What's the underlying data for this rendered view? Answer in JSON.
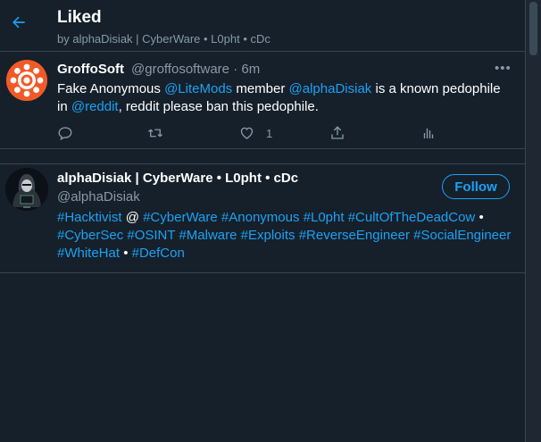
{
  "header": {
    "title": "Liked",
    "subtitle": "by alphaDisiak | CyberWare • L0pht • cDc"
  },
  "tweet": {
    "display_name": "GroffoSoft",
    "handle": "@groffosoftware",
    "separator": "·",
    "time": "6m",
    "more": "•••",
    "body": [
      {
        "t": "Fake Anonymous ",
        "link": false
      },
      {
        "t": "@LiteMods",
        "link": true
      },
      {
        "t": " member ",
        "link": false
      },
      {
        "t": "@alphaDisiak",
        "link": true
      },
      {
        "t": " is a known pedophile in ",
        "link": false
      },
      {
        "t": "@reddit",
        "link": true
      },
      {
        "t": ", reddit please ban this pedophile.",
        "link": false
      }
    ],
    "like_count": "1",
    "icons": [
      "reply-icon",
      "retweet-icon",
      "like-icon",
      "share-icon",
      "analytics-icon"
    ]
  },
  "user": {
    "display_name": "alphaDisiak | CyberWare • L0pht • cDc",
    "handle": "@alphaDisiak",
    "follow_label": "Follow",
    "bio": [
      {
        "t": "#Hacktivist",
        "link": true
      },
      {
        "t": " @ ",
        "link": false
      },
      {
        "t": "#CyberWare",
        "link": true
      },
      {
        "t": " ",
        "link": false
      },
      {
        "t": "#Anonymous",
        "link": true
      },
      {
        "t": " ",
        "link": false
      },
      {
        "t": "#L0pht",
        "link": true
      },
      {
        "t": " ",
        "link": false
      },
      {
        "t": "#CultOfTheDeadCow",
        "link": true
      },
      {
        "t": " • ",
        "link": false
      },
      {
        "t": "#CyberSec",
        "link": true
      },
      {
        "t": " ",
        "link": false
      },
      {
        "t": "#OSINT",
        "link": true
      },
      {
        "t": " ",
        "link": false
      },
      {
        "t": "#Malware",
        "link": true
      },
      {
        "t": " ",
        "link": false
      },
      {
        "t": "#Exploits",
        "link": true
      },
      {
        "t": " ",
        "link": false
      },
      {
        "t": "#ReverseEngineer",
        "link": true
      },
      {
        "t": " ",
        "link": false
      },
      {
        "t": "#SocialEngineer",
        "link": true
      },
      {
        "t": " ",
        "link": false
      },
      {
        "t": "#WhiteHat",
        "link": true
      },
      {
        "t": " • ",
        "link": false
      },
      {
        "t": "#DefCon",
        "link": true
      }
    ]
  },
  "colors": {
    "background": "#15202b",
    "accent": "#1da1f2",
    "muted": "#8899a6",
    "border": "#38444d"
  }
}
